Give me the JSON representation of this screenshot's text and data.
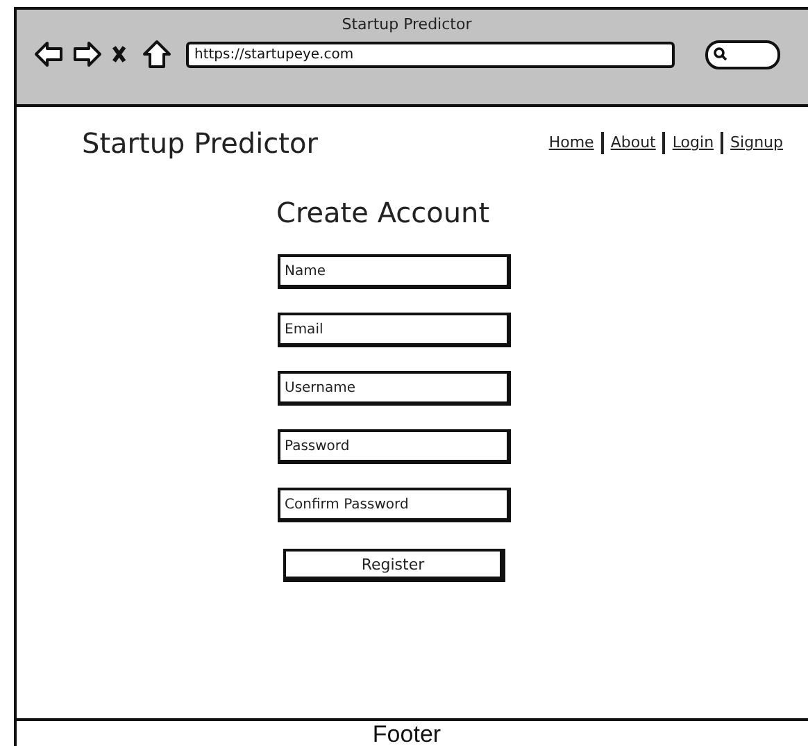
{
  "browser": {
    "title": "Startup Predictor",
    "address": "https://startupeye.com"
  },
  "header": {
    "brand": "Startup Predictor",
    "nav": [
      {
        "label": "Home"
      },
      {
        "label": "About"
      },
      {
        "label": "Login"
      },
      {
        "label": "Signup"
      }
    ]
  },
  "form": {
    "title": "Create Account",
    "fields": [
      {
        "placeholder": "Name"
      },
      {
        "placeholder": "Email"
      },
      {
        "placeholder": "Username"
      },
      {
        "placeholder": "Password"
      },
      {
        "placeholder": "Confirm Password"
      }
    ],
    "submit": "Register"
  },
  "footer": "Footer"
}
